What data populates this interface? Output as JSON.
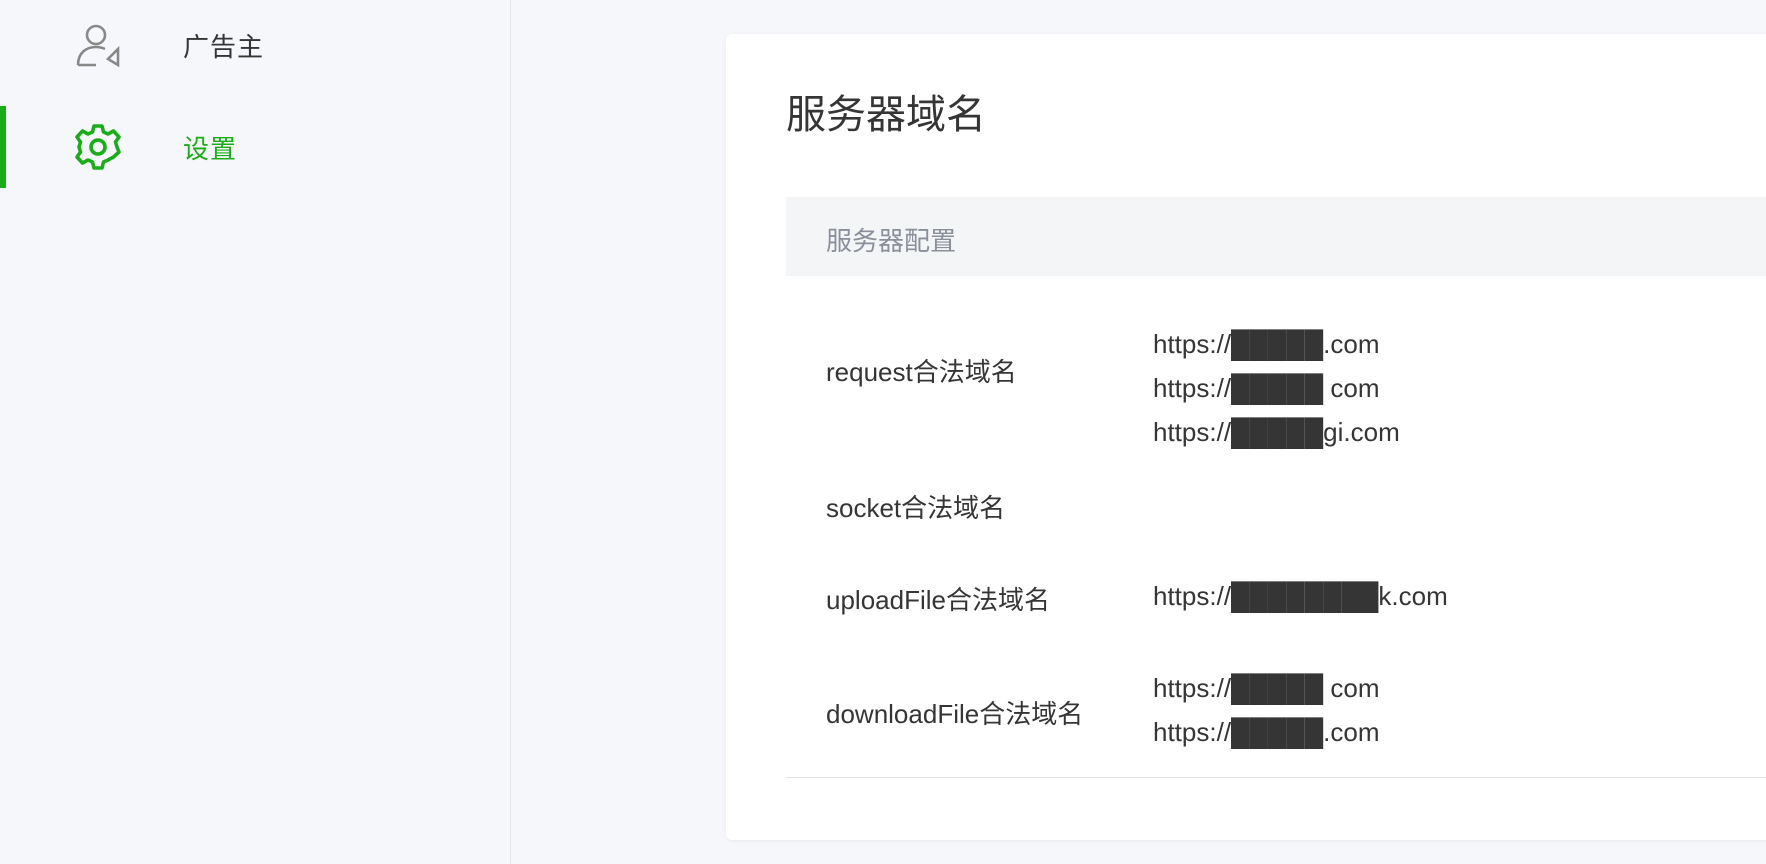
{
  "sidebar": {
    "items": [
      {
        "label": "广告主",
        "icon": "advertiser-icon",
        "active": false
      },
      {
        "label": "设置",
        "icon": "gear-icon",
        "active": true
      }
    ],
    "accent_color": "#1aad19"
  },
  "main": {
    "title": "服务器域名",
    "section_title": "服务器配置",
    "rows": [
      {
        "label": "request合法域名",
        "values": [
          "https://█████.com",
          "https://█████ com",
          "https://█████gi.com"
        ]
      },
      {
        "label": "socket合法域名",
        "values": []
      },
      {
        "label": "uploadFile合法域名",
        "values": [
          "https://████████k.com"
        ]
      },
      {
        "label": "downloadFile合法域名",
        "values": [
          "https://█████ com",
          "https://█████.com"
        ]
      }
    ]
  }
}
